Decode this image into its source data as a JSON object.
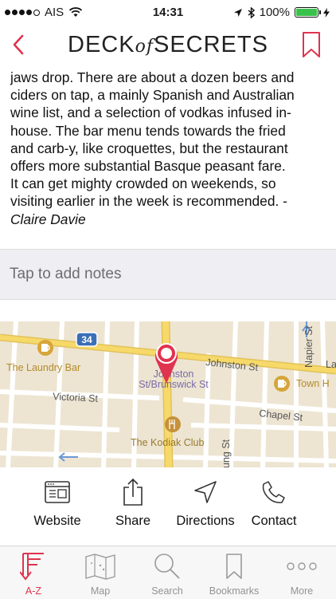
{
  "status": {
    "carrier": "AIS",
    "time": "14:31",
    "battery": "100%",
    "battery_level": 1.0
  },
  "nav": {
    "title_left": "DECK",
    "title_mid": "of",
    "title_right": "SECRETS"
  },
  "article": {
    "lines": [
      "jaws drop. There are about a dozen beers and",
      "ciders on tap, a mainly Spanish and Australian",
      "wine list, and a selection of vodkas infused in-",
      "house. The bar menu tends towards the fried",
      "and carb-y, like croquettes, but the restaurant",
      "offers more substantial Basque peasant fare.",
      "It can get mighty crowded on weekends, so",
      "visiting earlier in the week is recommended. -"
    ],
    "author": "Claire Davie"
  },
  "notes": {
    "placeholder": "Tap to add notes"
  },
  "map": {
    "pin_label_1": "Johnston",
    "pin_label_2": "St/Brunswick St",
    "laundry_bar": "The Laundry Bar",
    "johnston_st": "Johnston St",
    "victoria_st": "Victoria St",
    "chapel_st": "Chapel St",
    "kodiak_club": "The Kodiak Club",
    "town_hotel": "Town H",
    "napier_st": "Napier St",
    "route_34": "34",
    "la": "La",
    "ung_st": "ung St"
  },
  "actions": [
    "Website",
    "Share",
    "Directions",
    "Contact"
  ],
  "tabs": [
    {
      "label": "A-Z",
      "icon": "a-z-icon",
      "active": true
    },
    {
      "label": "Map",
      "icon": "map-icon",
      "active": false
    },
    {
      "label": "Search",
      "icon": "search-icon",
      "active": false
    },
    {
      "label": "Bookmarks",
      "icon": "bookmark-icon",
      "active": false
    },
    {
      "label": "More",
      "icon": "more-icon",
      "active": false
    }
  ],
  "colors": {
    "accent": "#e0334f",
    "map_background": "#ede5d2",
    "road_yellow": "#f7d96a",
    "notes_bg": "#efeff3"
  }
}
